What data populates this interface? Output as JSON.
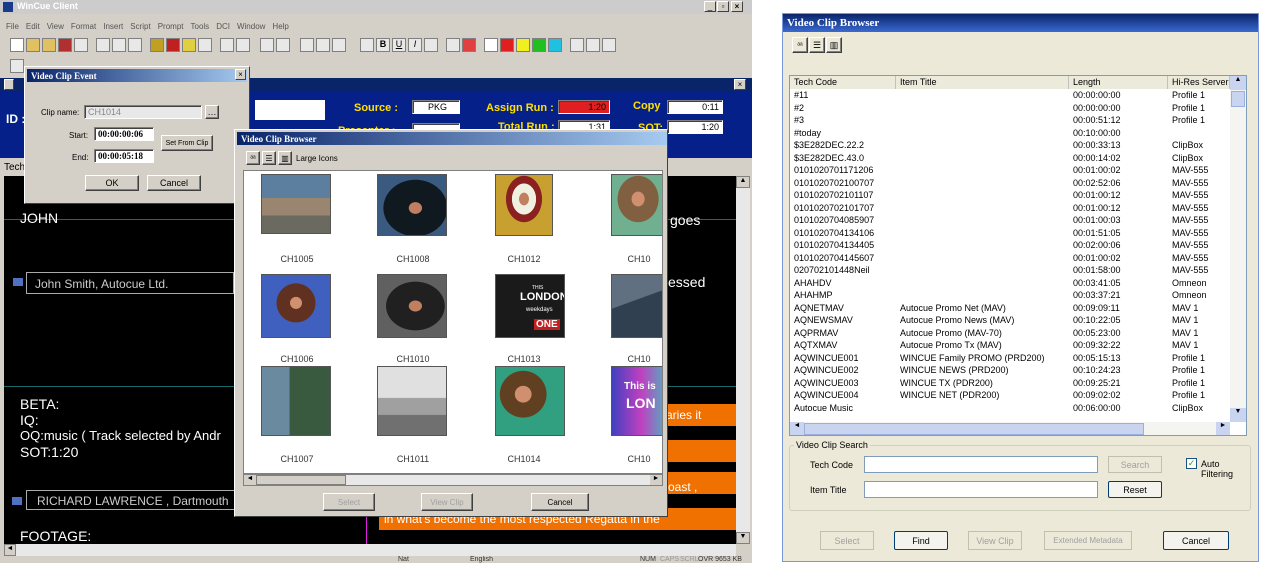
{
  "wincue": {
    "title": "WinCue Client",
    "menu": [
      "File",
      "Edit",
      "View",
      "Format",
      "Insert",
      "Script",
      "Prompt",
      "Tools",
      "DCI",
      "Window",
      "Help"
    ],
    "info": {
      "id_label": "ID :",
      "source_label": "Source :",
      "source_value": "PKG",
      "assign_run_label": "Assign Run :",
      "assign_run_value": "1:20",
      "copy_label": "Copy",
      "copy_value": "0:11",
      "presenter_label": "Presenter :",
      "presenter_value": "1:1",
      "total_run_label": "Total Run :",
      "total_run_value": "1:31",
      "sot_label": "SOT:",
      "sot_value": "1:20"
    },
    "tech_label": "Tech",
    "script": {
      "john": "JOHN",
      "goes": "goes",
      "john_smith": "John Smith, Autocue Ltd.",
      "essed": "essed",
      "beta": "BETA:",
      "iq": "IQ:",
      "oq": "OQ:music  ( Track selected by Andr",
      "sot": "SOT:1:20",
      "aries": "aries  it",
      "oast": "oast ,",
      "richard": "RICHARD LAWRENCE , Dartmouth",
      "regatta": "in what's become the most respected Regatta in the",
      "footage": "FOOTAGE:"
    },
    "status": [
      "Nat",
      "English",
      "NUM",
      "CAPS",
      "SCRL",
      "OVR 9653 KB"
    ]
  },
  "clip_event": {
    "title": "Video Clip Event",
    "clip_name_label": "Clip name:",
    "clip_name_value": "CH1014",
    "start_label": "Start:",
    "start_value": "00:00:00:06",
    "end_label": "End:",
    "end_value": "00:00:05:18",
    "set_from_clip": "Set From Clip",
    "ok": "OK",
    "cancel": "Cancel"
  },
  "browser_small": {
    "title": "Video Clip Browser",
    "view_label": "Large Icons",
    "clips": [
      "CH1005",
      "CH1008",
      "CH1012",
      "CH10",
      "CH1006",
      "CH1010",
      "CH1013",
      "CH10",
      "CH1007",
      "CH1011",
      "CH1014",
      "CH10"
    ],
    "select": "Select",
    "view_clip": "View Clip",
    "cancel": "Cancel",
    "thumb_texts": {
      "london_1": "THIS",
      "london_2": "LONDON",
      "london_3": "weekdays",
      "london_4": "ONE",
      "this_is": "This is",
      "lon": "LON"
    }
  },
  "browser_large": {
    "title": "Video Clip Browser",
    "columns": [
      "Tech Code",
      "Item Title",
      "Length",
      "Hi-Res Server"
    ],
    "rows": [
      [
        "#11",
        "",
        "00:00:00:00",
        "Profile 1"
      ],
      [
        "#2",
        "",
        "00:00:00:00",
        "Profile 1"
      ],
      [
        "#3",
        "",
        "00:00:51:12",
        "Profile 1"
      ],
      [
        "#today",
        "",
        "00:10:00:00",
        ""
      ],
      [
        "$3E282DEC.22.2",
        "",
        "00:00:33:13",
        "ClipBox"
      ],
      [
        "$3E282DEC.43.0",
        "",
        "00:00:14:02",
        "ClipBox"
      ],
      [
        "0101020701171206",
        "",
        "00:01:00:02",
        "MAV-555"
      ],
      [
        "0101020702100707",
        "",
        "00:02:52:06",
        "MAV-555"
      ],
      [
        "0101020702101107",
        "",
        "00:01:00:12",
        "MAV-555"
      ],
      [
        "0101020702101707",
        "",
        "00:01:00:12",
        "MAV-555"
      ],
      [
        "0101020704085907",
        "",
        "00:01:00:03",
        "MAV-555"
      ],
      [
        "0101020704134106",
        "",
        "00:01:51:05",
        "MAV-555"
      ],
      [
        "0101020704134405",
        "",
        "00:02:00:06",
        "MAV-555"
      ],
      [
        "0101020704145607",
        "",
        "00:01:00:02",
        "MAV-555"
      ],
      [
        "020702101448Neil",
        "",
        "00:01:58:00",
        "MAV-555"
      ],
      [
        "AHAHDV",
        "",
        "00:03:41:05",
        "Omneon"
      ],
      [
        "AHAHMP",
        "",
        "00:03:37:21",
        "Omneon"
      ],
      [
        "AQNETMAV",
        "Autocue Promo Net (MAV)",
        "00:09:09:11",
        "MAV 1"
      ],
      [
        "AQNEWSMAV",
        "Autocue Promo News (MAV)",
        "00:10:22:05",
        "MAV 1"
      ],
      [
        "AQPRMAV",
        "Autocue Promo (MAV-70)",
        "00:05:23:00",
        "MAV 1"
      ],
      [
        "AQTXMAV",
        "Autocue Promo Tx (MAV)",
        "00:09:32:22",
        "MAV 1"
      ],
      [
        "AQWINCUE001",
        "WINCUE Family PROMO (PRD200)",
        "00:05:15:13",
        "Profile 1"
      ],
      [
        "AQWINCUE002",
        "WINCUE NEWS (PRD200)",
        "00:10:24:23",
        "Profile 1"
      ],
      [
        "AQWINCUE003",
        "WINCUE TX (PDR200)",
        "00:09:25:21",
        "Profile 1"
      ],
      [
        "AQWINCUE004",
        "WINCUE NET (PDR200)",
        "00:09:02:02",
        "Profile 1"
      ],
      [
        "Autocue Music",
        "",
        "00:06:00:00",
        "ClipBox"
      ]
    ],
    "search_group": "Video Clip Search",
    "tech_code_label": "Tech Code",
    "item_title_label": "Item Title",
    "search": "Search",
    "reset": "Reset",
    "auto_filtering": "Auto Filtering",
    "buttons": {
      "select": "Select",
      "find": "Find",
      "view_clip": "View Clip",
      "extended": "Extended Metadata",
      "cancel": "Cancel"
    }
  }
}
